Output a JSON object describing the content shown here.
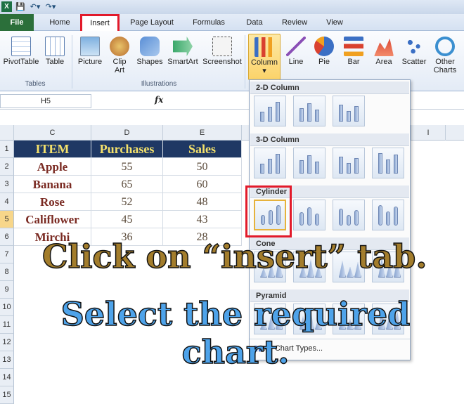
{
  "window": {
    "app_icon": "X"
  },
  "tabs": [
    {
      "id": "file",
      "label": "File"
    },
    {
      "id": "home",
      "label": "Home"
    },
    {
      "id": "insert",
      "label": "Insert"
    },
    {
      "id": "page_layout",
      "label": "Page Layout"
    },
    {
      "id": "formulas",
      "label": "Formulas"
    },
    {
      "id": "data",
      "label": "Data"
    },
    {
      "id": "review",
      "label": "Review"
    },
    {
      "id": "view",
      "label": "View"
    }
  ],
  "ribbon": {
    "pivottable": "PivotTable",
    "table": "Table",
    "picture": "Picture",
    "clip_art_1": "Clip",
    "clip_art_2": "Art",
    "shapes": "Shapes",
    "smartart": "SmartArt",
    "screenshot": "Screenshot",
    "column": "Column",
    "line": "Line",
    "pie": "Pie",
    "bar": "Bar",
    "area": "Area",
    "scatter": "Scatter",
    "other_1": "Other",
    "other_2": "Charts",
    "group_tables": "Tables",
    "group_illustrations": "Illustrations"
  },
  "formula_bar": {
    "name_box": "H5",
    "fx": "fx"
  },
  "columns": [
    "C",
    "D",
    "E",
    "I"
  ],
  "rows": [
    "1",
    "2",
    "3",
    "4",
    "5",
    "6",
    "7",
    "8",
    "9",
    "10",
    "11",
    "12",
    "13",
    "14",
    "15"
  ],
  "table": {
    "headers": [
      "ITEM",
      "Purchases",
      "Sales"
    ],
    "rows": [
      [
        "Apple",
        "55",
        "50"
      ],
      [
        "Banana",
        "65",
        "60"
      ],
      [
        "Rose",
        "52",
        "48"
      ],
      [
        "Califlower",
        "45",
        "43"
      ],
      [
        "Mirchi",
        "36",
        "28"
      ]
    ]
  },
  "dropdown": {
    "sec_2d": "2-D Column",
    "sec_3d": "3-D Column",
    "sec_cyl": "Cylinder",
    "sec_cone": "Cone",
    "sec_pyr": "Pyramid",
    "all_types": "All Chart Types..."
  },
  "captions": {
    "line1": "Click on “insert” tab.",
    "line2": "Select the required chart."
  },
  "colors": {
    "accent_red": "#e21a2a",
    "header_fill": "#1f3864",
    "header_text": "#f5e26b"
  }
}
